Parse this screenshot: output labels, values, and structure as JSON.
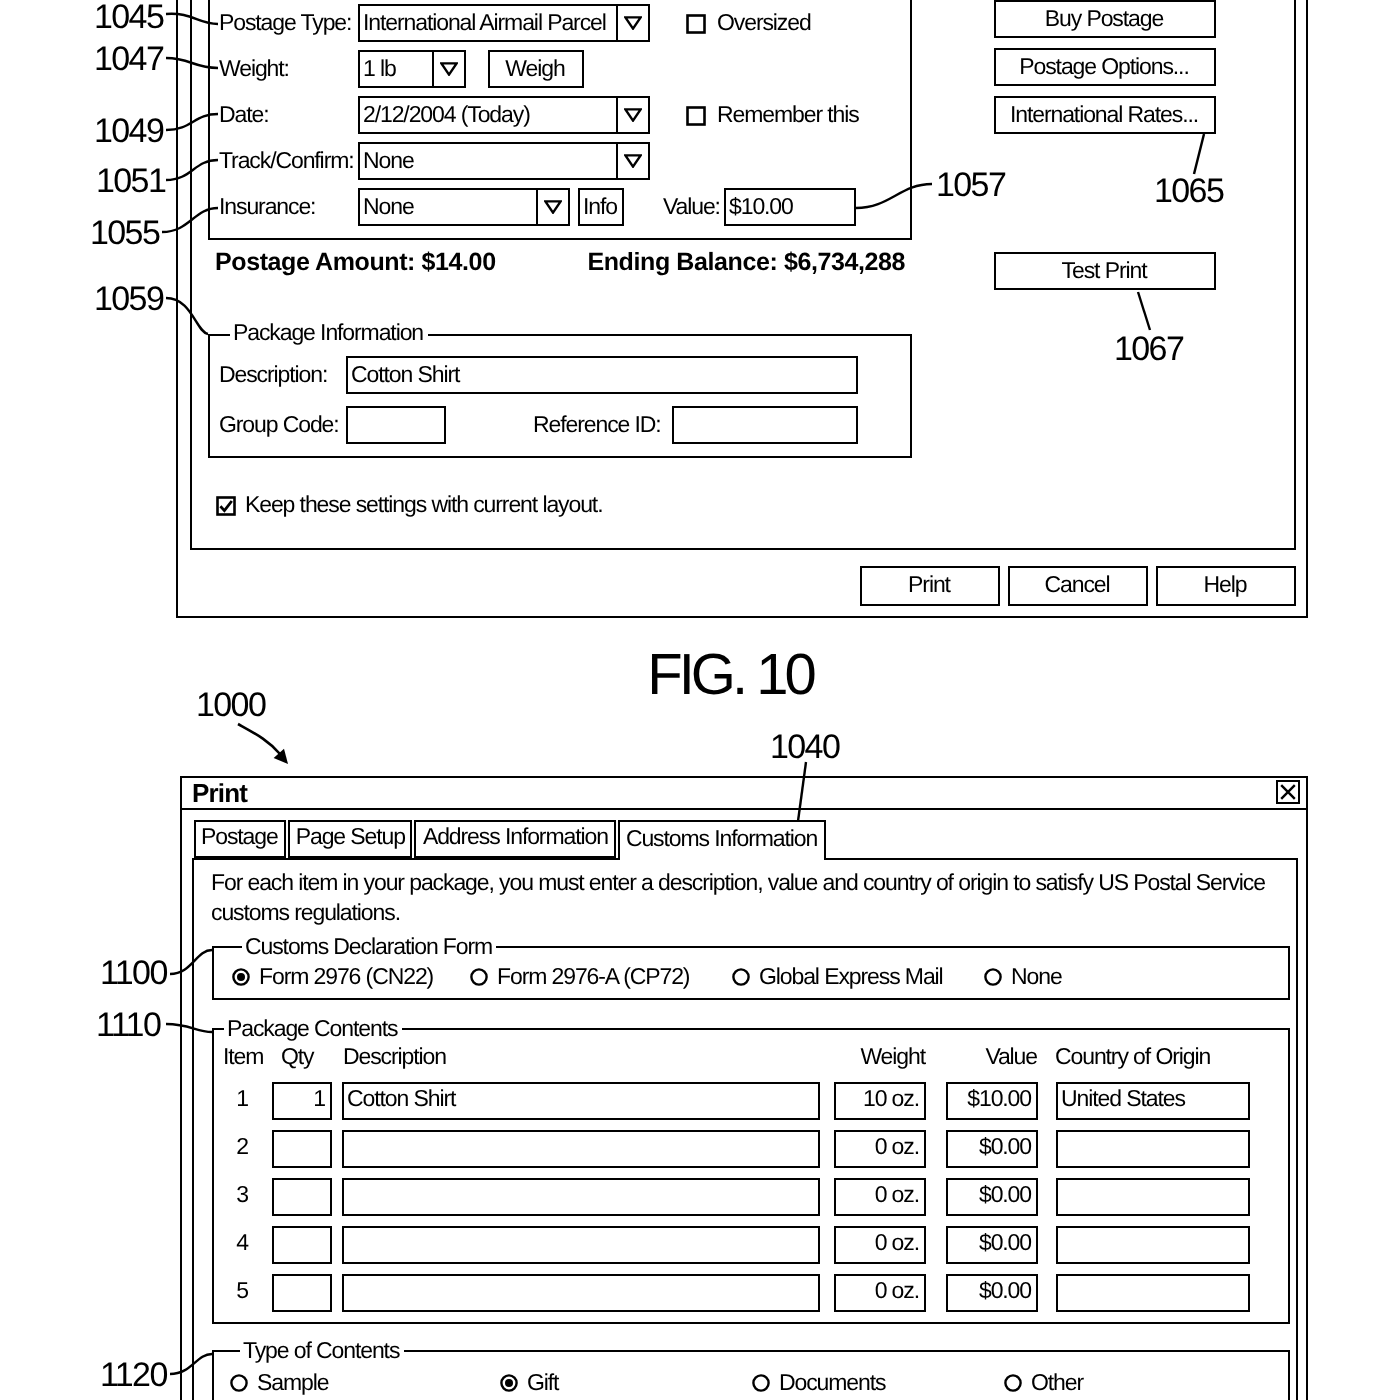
{
  "postage_window": {
    "fields": [
      {
        "kind": "dropdown",
        "label": "Postage Type:",
        "value": "International Airmail Parcel",
        "checkbox": {
          "label": "Oversized",
          "checked": false
        }
      },
      {
        "kind": "weight",
        "label": "Weight:",
        "value": "1 lb",
        "button": "Weigh"
      },
      {
        "kind": "dropdown",
        "label": "Date:",
        "value": "2/12/2004 (Today)",
        "checkbox": {
          "label": "Remember this",
          "checked": false
        }
      },
      {
        "kind": "dropdown",
        "label": "Track/Confirm:",
        "value": "None"
      },
      {
        "kind": "insurance",
        "label": "Insurance:",
        "value": "None",
        "button": "Info",
        "value_label": "Value:",
        "amount": "$10.00"
      }
    ],
    "postage_amount": "Postage Amount: $14.00",
    "ending_balance": "Ending Balance: $6,734,288",
    "side_buttons": [
      "Buy Postage",
      "Postage Options...",
      "International Rates..."
    ],
    "test_print_button": "Test Print",
    "package_information": {
      "title": "Package Information",
      "description_label": "Description:",
      "description": "Cotton Shirt",
      "group_code_label": "Group Code:",
      "reference_id_label": "Reference ID:"
    },
    "keep_settings": {
      "label": "Keep these settings with current layout.",
      "checked": true
    },
    "buttons": [
      "Print",
      "Cancel",
      "Help"
    ]
  },
  "figure_caption": "FIG. 10",
  "print_dialog": {
    "title": "Print",
    "tabs": [
      {
        "label": "Postage",
        "selected": false
      },
      {
        "label": "Page Setup",
        "selected": false
      },
      {
        "label": "Address Information",
        "selected": false
      },
      {
        "label": "Customs Information",
        "selected": true
      }
    ],
    "instructions": "For each item in your package, you must enter a description, value and country of origin to satisfy US Postal Service customs regulations.",
    "customs_declaration_form": {
      "title": "Customs Declaration Form",
      "options": [
        {
          "label": "Form 2976 (CN22)",
          "selected": true
        },
        {
          "label": "Form 2976-A (CP72)",
          "selected": false
        },
        {
          "label": "Global Express Mail",
          "selected": false
        },
        {
          "label": "None",
          "selected": false
        }
      ]
    },
    "package_contents": {
      "title": "Package Contents",
      "columns": [
        "Item",
        "Qty",
        "Description",
        "Weight",
        "Value",
        "Country of Origin"
      ],
      "rows": [
        {
          "item": "1",
          "qty": "1",
          "description": "Cotton Shirt",
          "weight": "10 oz.",
          "value": "$10.00",
          "country_of_origin": "United States"
        },
        {
          "item": "2",
          "weight": "0 oz.",
          "value": "$0.00"
        },
        {
          "item": "3",
          "weight": "0 oz.",
          "value": "$0.00"
        },
        {
          "item": "4",
          "weight": "0 oz.",
          "value": "$0.00"
        },
        {
          "item": "5",
          "weight": "0 oz.",
          "value": "$0.00"
        }
      ]
    },
    "type_of_contents": {
      "title": "Type of Contents",
      "options": [
        {
          "label": "Sample",
          "selected": false
        },
        {
          "label": "Gift",
          "selected": true
        },
        {
          "label": "Documents",
          "selected": false
        },
        {
          "label": "Other",
          "selected": false
        }
      ]
    }
  },
  "callouts": [
    "1045",
    "1047",
    "1049",
    "1051",
    "1057",
    "1065",
    "1055",
    "1059",
    "1067",
    "1000",
    "1040",
    "1100",
    "1110",
    "1120"
  ]
}
